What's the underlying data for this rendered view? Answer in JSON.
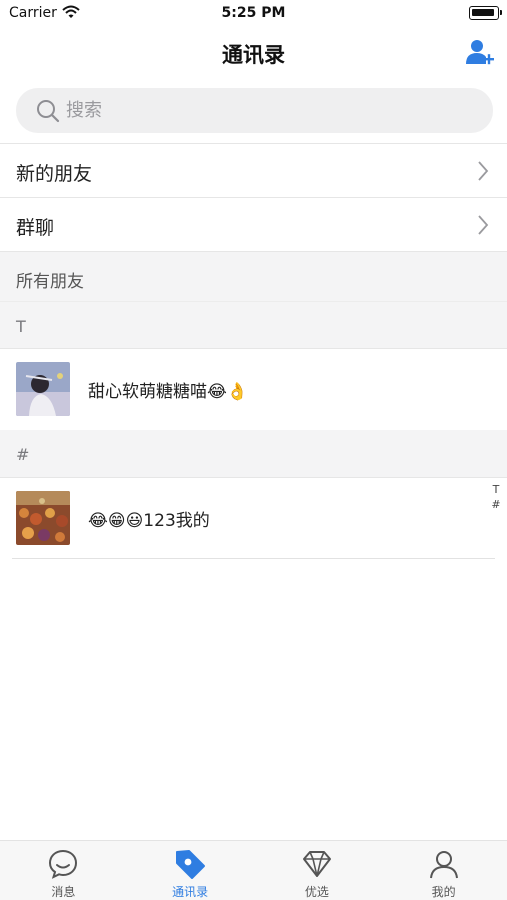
{
  "status_bar": {
    "carrier": "Carrier",
    "time": "5:25 PM"
  },
  "nav": {
    "title": "通讯录",
    "add_icon": "add-contact-icon"
  },
  "search": {
    "placeholder": "搜索"
  },
  "menu": [
    {
      "label": "新的朋友"
    },
    {
      "label": "群聊"
    }
  ],
  "all_friends_label": "所有朋友",
  "sections": [
    {
      "letter": "T",
      "contacts": [
        {
          "name": "甜心软萌糖糖喵😂👌"
        }
      ]
    },
    {
      "letter": "#",
      "contacts": [
        {
          "name": "😂😁😃123我的"
        }
      ]
    }
  ],
  "index_letters": [
    "T",
    "#"
  ],
  "tabs": [
    {
      "label": "消息",
      "icon": "chat-bubble-icon",
      "active": false
    },
    {
      "label": "通讯录",
      "icon": "tag-icon",
      "active": true
    },
    {
      "label": "优选",
      "icon": "diamond-icon",
      "active": false
    },
    {
      "label": "我的",
      "icon": "person-icon",
      "active": false
    }
  ],
  "colors": {
    "accent": "#2f7de1",
    "section_bg": "#f4f4f5",
    "search_bg": "#efeff0"
  }
}
